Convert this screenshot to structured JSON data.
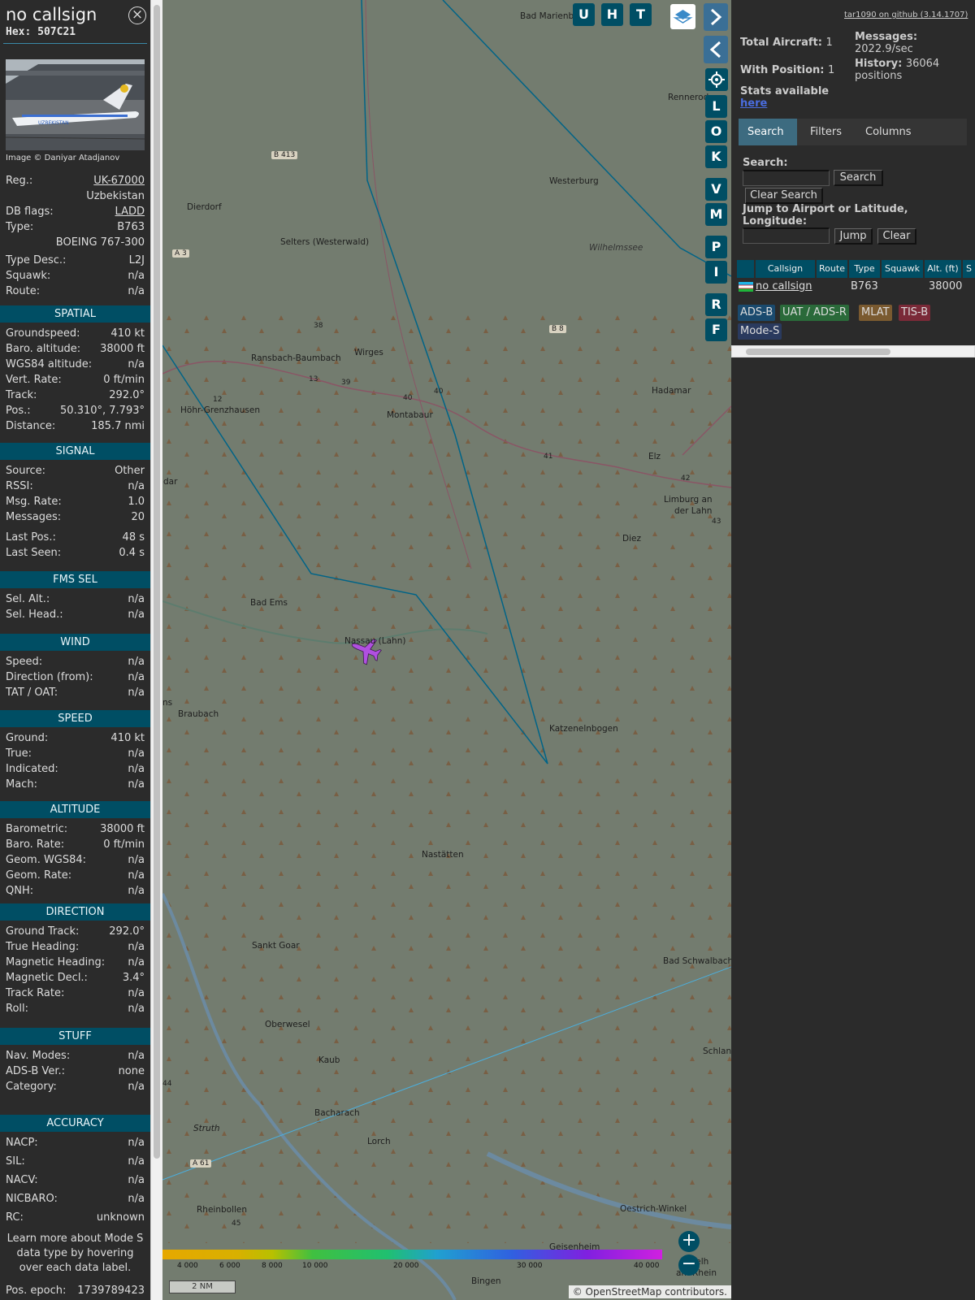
{
  "infoblock": {
    "title": "no callsign",
    "hex": "Hex: 507C21",
    "image_credit": "Image © Daniyar Atadjanov",
    "photo_airline_text": "UZBEKISTAN",
    "header_rows": [
      {
        "label": "Reg.:",
        "value": "UK-67000"
      },
      {
        "label": "",
        "value": "Uzbekistan"
      },
      {
        "label": "DB flags:",
        "value": "LADD"
      },
      {
        "label": "Type:",
        "value": "B763"
      },
      {
        "label": "",
        "value": "BOEING 767-300"
      },
      {
        "label": "Type Desc.:",
        "value": "L2J"
      },
      {
        "label": "Squawk:",
        "value": "n/a"
      },
      {
        "label": "Route:",
        "value": "n/a"
      }
    ],
    "sections": [
      {
        "title": "SPATIAL",
        "rows": [
          {
            "label": "Groundspeed:",
            "value": "410 kt"
          },
          {
            "label": "Baro. altitude:",
            "value": "38000 ft"
          },
          {
            "label": "WGS84 altitude:",
            "value": "n/a"
          },
          {
            "label": "Vert. Rate:",
            "value": "0 ft/min"
          },
          {
            "label": "Track:",
            "value": "292.0°"
          },
          {
            "label": "Pos.:",
            "value": "50.310°, 7.793°"
          },
          {
            "label": "Distance:",
            "value": "185.7 nmi"
          }
        ]
      },
      {
        "title": "SIGNAL",
        "rows": [
          {
            "label": "Source:",
            "value": "Other"
          },
          {
            "label": "RSSI:",
            "value": "n/a"
          },
          {
            "label": "Msg. Rate:",
            "value": "1.0"
          },
          {
            "label": "Messages:",
            "value": "20"
          },
          {
            "label": "Last Pos.:",
            "value": "48 s"
          },
          {
            "label": "Last Seen:",
            "value": "0.4 s"
          }
        ]
      },
      {
        "title": "FMS SEL",
        "rows": [
          {
            "label": "Sel. Alt.:",
            "value": "n/a"
          },
          {
            "label": "Sel. Head.:",
            "value": "n/a"
          }
        ]
      },
      {
        "title": "WIND",
        "rows": [
          {
            "label": "Speed:",
            "value": "n/a"
          },
          {
            "label": "Direction (from):",
            "value": "n/a"
          },
          {
            "label": "TAT / OAT:",
            "value": "n/a"
          }
        ]
      },
      {
        "title": "SPEED",
        "rows": [
          {
            "label": "Ground:",
            "value": "410 kt"
          },
          {
            "label": "True:",
            "value": "n/a"
          },
          {
            "label": "Indicated:",
            "value": "n/a"
          },
          {
            "label": "Mach:",
            "value": "n/a"
          }
        ]
      },
      {
        "title": "ALTITUDE",
        "rows": [
          {
            "label": "Barometric:",
            "value": "38000 ft"
          },
          {
            "label": "Baro. Rate:",
            "value": "0 ft/min"
          },
          {
            "label": "Geom. WGS84:",
            "value": "n/a"
          },
          {
            "label": "Geom. Rate:",
            "value": "n/a"
          },
          {
            "label": "QNH:",
            "value": "n/a"
          }
        ]
      },
      {
        "title": "DIRECTION",
        "rows": [
          {
            "label": "Ground Track:",
            "value": "292.0°"
          },
          {
            "label": "True Heading:",
            "value": "n/a"
          },
          {
            "label": "Magnetic Heading:",
            "value": "n/a"
          },
          {
            "label": "Magnetic Decl.:",
            "value": "3.4°"
          },
          {
            "label": "Track Rate:",
            "value": "n/a"
          },
          {
            "label": "Roll:",
            "value": "n/a"
          }
        ]
      },
      {
        "title": "STUFF",
        "rows": [
          {
            "label": "Nav. Modes:",
            "value": "n/a"
          },
          {
            "label": "ADS-B Ver.:",
            "value": "none"
          },
          {
            "label": "Category:",
            "value": "n/a"
          }
        ]
      },
      {
        "title": "ACCURACY",
        "rows": [
          {
            "label": "NACP:",
            "value": "n/a"
          },
          {
            "label": "SIL:",
            "value": "n/a"
          },
          {
            "label": "NACV:",
            "value": "n/a"
          },
          {
            "label": "NICBARO:",
            "value": "n/a"
          },
          {
            "label": "RC:",
            "value": "unknown"
          }
        ]
      }
    ],
    "learn_more": "Learn more about Mode S data type by hovering over each data label.",
    "pos_epoch": {
      "label": "Pos. epoch:",
      "value": "1739789423"
    }
  },
  "map": {
    "toolbar_buttons": [
      "U",
      "H",
      "T"
    ],
    "side_buttons": [
      "L",
      "O",
      "K",
      "V",
      "M",
      "P",
      "I",
      "R",
      "F"
    ],
    "places": [
      "Bad Marienberg",
      "Rennerod",
      "Westerburg",
      "B 413",
      "Dierdorf",
      "Selters (Westerwald)",
      "Wilhelmssee",
      "A 3",
      "Ransbach-Baumbach",
      "Wirges",
      "B 8",
      "Hadamar",
      "Höhr-Grenzhausen",
      "Montabaur",
      "Elz",
      "Limburg an",
      "der Lahn",
      "Diez",
      "Bad Ems",
      "Nassau (Lahn)",
      "Braubach",
      "Katzenelnbogen",
      "Nastätten",
      "Sankt Goar",
      "Bad Schwalbach",
      "Oberwesel",
      "Kaub",
      "Schlang",
      "Bacharach",
      "Struth",
      "Lorch",
      "A 61",
      "Rheinbollen",
      "Oestrich-Winkel",
      "Geisenheim",
      "Bingen",
      "dar",
      "ns",
      "nigelh",
      "am Rhein"
    ],
    "road_numbers": [
      "38",
      "13",
      "39",
      "40",
      "40",
      "12",
      "41",
      "42",
      "43",
      "45",
      "44"
    ],
    "altitude_scale": [
      "4 000",
      "6 000",
      "8 000",
      "10 000",
      "20 000",
      "30 000",
      "40 000"
    ],
    "scale_label": "2 NM",
    "attribution": "© OpenStreetMap contributors.",
    "zoom_in": "+",
    "zoom_out": "−"
  },
  "panel": {
    "github_link": "tar1090 on github (3.14.1707)",
    "total_aircraft_label": "Total Aircraft:",
    "total_aircraft": "1",
    "with_position_label": "With Position:",
    "with_position": "1",
    "messages_label": "Messages:",
    "messages": "2022.9/sec",
    "history_label": "History:",
    "history": "36064 positions",
    "stats_label": "Stats available",
    "stats_link": "here",
    "tabs": [
      "Search",
      "Filters",
      "Columns"
    ],
    "search_label": "Search:",
    "search_button": "Search",
    "clear_search_button": "Clear Search",
    "jump_label": "Jump to Airport or Latitude, Longitude:",
    "jump_button": "Jump",
    "clear_button": "Clear",
    "table": {
      "headers": [
        "Callsign",
        "Route",
        "Type",
        "Squawk",
        "Alt. (ft)",
        "S"
      ],
      "rows": [
        {
          "callsign": "no callsign",
          "route": "",
          "type": "B763",
          "squawk": "",
          "alt": "38000"
        }
      ]
    },
    "source_badges": [
      {
        "label": "ADS-B",
        "color": "#1a4a6e"
      },
      {
        "label": "UAT / ADS-R",
        "color": "#2a6a3a"
      },
      {
        "label": "MLAT",
        "color": "#7a5a30"
      },
      {
        "label": "TIS-B",
        "color": "#7a2a38"
      },
      {
        "label": "Mode-S",
        "color": "#2a3a5e"
      }
    ]
  },
  "colors": {
    "section_header": "#004e64",
    "map_background": "#717a6d",
    "track_line": "#006487",
    "aircraft": "#b050e0"
  }
}
